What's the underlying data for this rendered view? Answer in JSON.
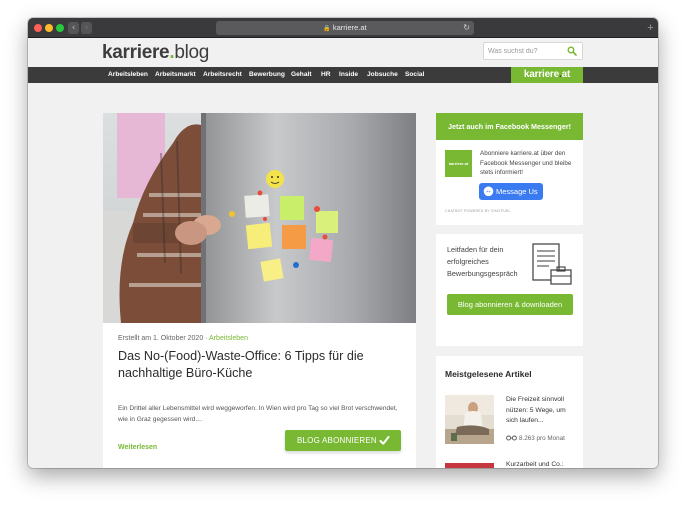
{
  "browser": {
    "url": "karriere.at",
    "back_glyph": "‹",
    "forward_glyph": "›",
    "new_tab_glyph": "+"
  },
  "header": {
    "logo_part1": "karriere",
    "logo_dot": ".",
    "logo_part2": "blog",
    "search_placeholder": "Was suchst du?"
  },
  "nav": {
    "items": [
      "Arbeitsleben",
      "Arbeitsmarkt",
      "Arbeitsrecht",
      "Bewerbung",
      "Gehalt",
      "HR",
      "Inside",
      "Jobsuche",
      "Social"
    ],
    "brand_part1": "karriere",
    "brand_dot": ".",
    "brand_part2": "at"
  },
  "article": {
    "meta_prefix": "Erstellt am 1. Oktober 2020 · ",
    "meta_category": "Arbeitsleben",
    "title": "Das No-(Food)-Waste-Office: 6 Tipps für die nachhaltige Büro-Küche",
    "excerpt": "Ein Drittel aller Lebensmittel wird weggeworfen. In Wien wird pro Tag so viel Brot verschwendet, wie in Graz gegessen wird....",
    "read_more": "Weiterlesen",
    "subscribe_label": "BLOG ABONNIEREN"
  },
  "sidebar": {
    "facebook": {
      "header": "Jetzt auch im Facebook Messenger!",
      "avatar_text": "karriere.at",
      "text": "Abonniere karriere.at über den Facebook Messenger und bleibe stets informiert!",
      "button": "Message Us",
      "powered": "CHATBOT POWERED BY CHATFUEL"
    },
    "guide": {
      "text": "Leitfaden für dein erfolgreiches Bewerbungsgespräch",
      "button": "Blog abonnieren & downloaden"
    },
    "popular": {
      "title": "Meistgelesene Artikel",
      "items": [
        {
          "title": "Die Freizeit sinnvoll nützen: 5 Wege, um sich laufen...",
          "views": "8.263 pro Monat"
        },
        {
          "title": "Kurzarbeit und Co.:"
        }
      ]
    }
  },
  "colors": {
    "brand_green": "#78b833",
    "nav_dark": "#3b3b3b",
    "messenger_blue": "#3a7bf2"
  }
}
